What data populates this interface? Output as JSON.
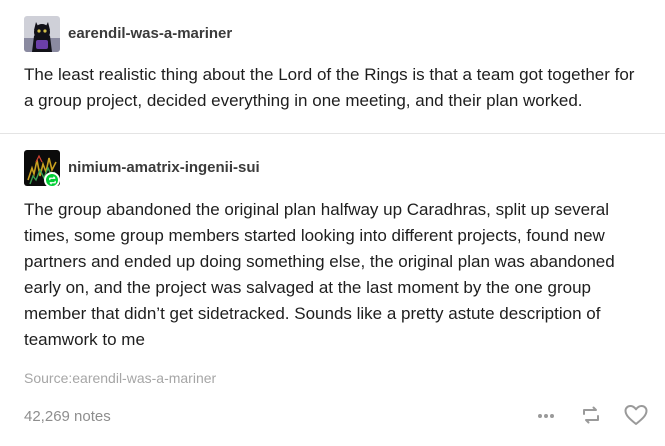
{
  "post": {
    "original": {
      "username": "earendil-was-a-mariner",
      "text": "The least realistic thing about the Lord of the Rings is that a team got together for a group project, decided everything in one meeting, and their plan worked."
    },
    "reblog": {
      "username": "nimium-amatrix-ingenii-sui",
      "text": "The group abandoned the original plan halfway up Caradhras, split up several times, some group members started looking into different projects, found new partners and ended up doing something else, the original plan was abandoned early on, and the project was salvaged at the last moment by the one group member that didn’t get sidetracked. Sounds like a pretty astute description of teamwork to me"
    },
    "source": "Source:earendil-was-a-mariner",
    "notes": "42,269 notes"
  },
  "icons": {
    "more": "more-dots-icon",
    "reblog": "reblog-icon",
    "like": "heart-icon",
    "badge": "reblog-badge-icon"
  },
  "colors": {
    "text": "#1e1e1e",
    "muted": "#8e8e8e",
    "reblog_green": "#00cf35"
  }
}
